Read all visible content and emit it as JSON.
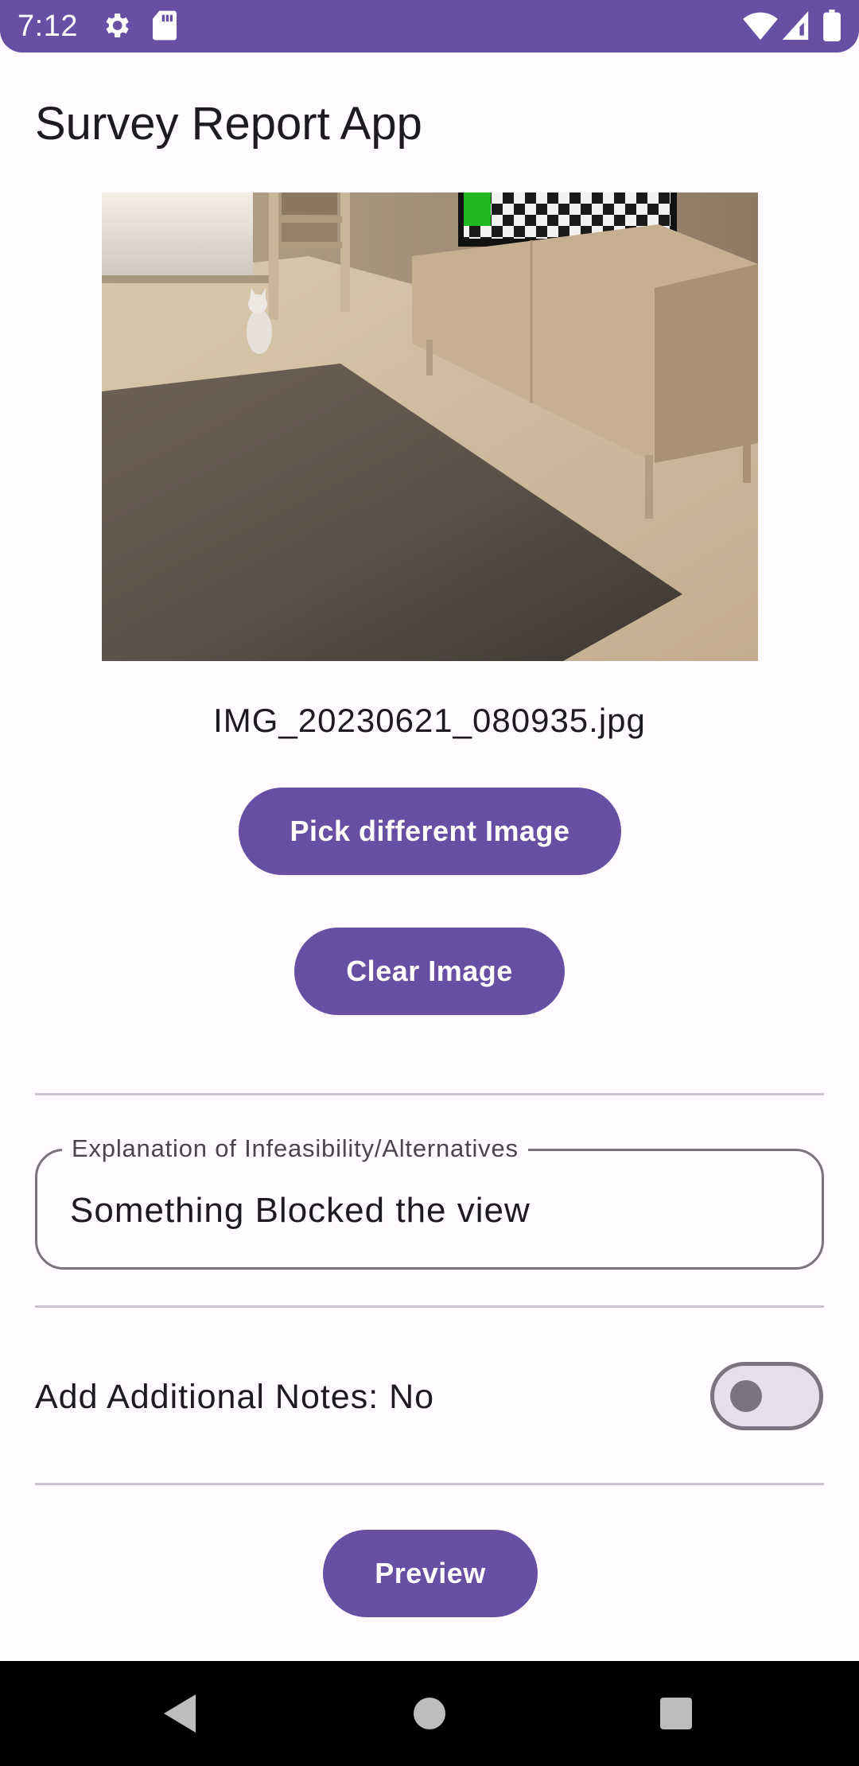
{
  "status_bar": {
    "time": "7:12",
    "icons": [
      "gear-icon",
      "sd-card-icon",
      "wifi-icon",
      "signal-icon",
      "battery-icon"
    ]
  },
  "app": {
    "title": "Survey Report App"
  },
  "image": {
    "file_name": "IMG_20230621_080935.jpg",
    "pick_label": "Pick different Image",
    "clear_label": "Clear Image"
  },
  "explanation": {
    "label": "Explanation of Infeasibility/Alternatives",
    "value": "Something Blocked the view"
  },
  "notes": {
    "label": "Add Additional Notes: No",
    "enabled": false
  },
  "actions": {
    "preview_label": "Preview"
  },
  "nav_bar": {
    "icons": [
      "back-icon",
      "home-icon",
      "recents-icon"
    ]
  },
  "colors": {
    "primary": "#6750a4",
    "background": "#fffbfe",
    "outline": "#79747e",
    "divider": "#cac4d0"
  }
}
